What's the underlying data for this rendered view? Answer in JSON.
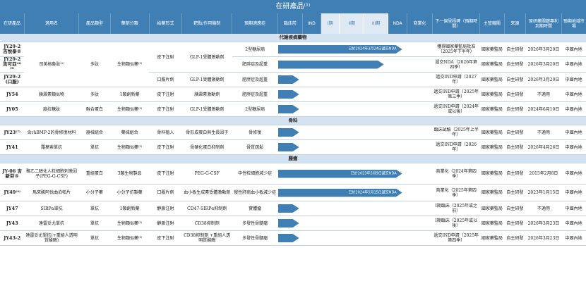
{
  "title": "在研產品⁽¹⁾",
  "headers": [
    "在研產品",
    "適用名",
    "產品類型",
    "藥劑分類",
    "給藥形式",
    "靶點/作用機制",
    "預期適應症",
    "臨床前",
    "IND",
    "I期",
    "II期",
    "III期",
    "NDA",
    "商業化",
    "下一個里程碑（預期時間）",
    "主管機關",
    "來源",
    "原研藥關鍵專利到期時間",
    "預期地域市場"
  ],
  "sections": {
    "s1": "代謝疾病藥物",
    "s2": "骨科",
    "s3": "腫瘤"
  },
  "rows": {
    "r1": {
      "code": "JY29-2 吉悅泰®",
      "name": "司美格魯肽⁽²⁾",
      "type": "多肽",
      "cls": "生物類似藥⁽³⁾",
      "form": "皮下注射",
      "target": "GLP-1受體激動劑",
      "ind": "2型糖尿病",
      "note": "已於2024年3月24日遞交NDA",
      "milestone": "獲得國家藥監局批准（2025年下半年）",
      "authority": "國家藥監局",
      "source": "自主研發",
      "patent": "2026年3月20日",
      "market": "中國內地"
    },
    "r2": {
      "code": "JY29-2 吉可亞⁽⁴⁾⁽⁵⁾",
      "ind": "肥胖症及超重",
      "milestone": "遞交NDA（2026年第四季）",
      "authority": "國家藥監局",
      "source": "自主研發",
      "patent": "2026年3月20日",
      "market": "中國內地"
    },
    "r3": {
      "code": "JY29-2 (口服)",
      "form": "口服片劑",
      "ind": "肥胖症及超重",
      "milestone": "遞交IND申請（2027年）",
      "authority": "國家藥監局",
      "source": "自主研發",
      "patent": "2026年3月20日",
      "market": "中國內地"
    },
    "r4": {
      "code": "JY54",
      "name": "胰澱素類似物",
      "type": "多肽",
      "cls": "1類創新藥",
      "form": "皮下注射",
      "target": "胰澱素激動劑",
      "ind": "肥胖症及超重",
      "milestone": "遞交IND申請（2025年第三季）",
      "authority": "國家藥監局",
      "source": "自主研發",
      "patent": "不適用",
      "market": "中國內地"
    },
    "r5": {
      "code": "JY05",
      "name": "度拉糖肽",
      "type": "融合蛋白",
      "cls": "生物類似藥⁽³⁾",
      "form": "皮下注射",
      "target": "GLP-1受體激動劑",
      "ind": "2型糖尿病",
      "milestone": "遞交IND申請（2024年或以後）",
      "authority": "國家藥監局",
      "source": "自主研發",
      "patent": "2024年6月10日",
      "market": "中國內地"
    },
    "r6": {
      "code": "JY23⁽⁷⁾",
      "name": "含rhBMP-2的骨修復材料",
      "type": "器械組合",
      "cls": "藥械組合",
      "form": "骨科植入",
      "target": "骨形成蛋白與生長因子",
      "ind": "骨修復",
      "milestone": "臨床試驗（2025年上半年）",
      "authority": "國家藥監局",
      "source": "自主研發",
      "patent": "不適用",
      "market": "中國內地"
    },
    "r7": {
      "code": "JY41",
      "name": "羅莫索單抗",
      "type": "單抗",
      "cls": "生物類似藥⁽³⁾",
      "form": "皮下注射",
      "target": "骨硬化蛋白抑制劑",
      "ind": "骨質疏鬆",
      "milestone": "遞交IND申請（2026年）",
      "authority": "國家藥監局",
      "source": "自主研發",
      "patent": "2026年4月26日",
      "market": "中國內地"
    },
    "r8": {
      "code": "JY-06 吉新芬®",
      "name": "聚乙二醇化人粒細胞刺激因子(PEG-G-CSF)",
      "type": "重組蛋白",
      "cls": "3類生物製品",
      "form": "皮下注射",
      "target": "PEG-G-CSF",
      "ind": "中性粒細胞減少症",
      "note": "已於2023年5月9日遞交NDA",
      "milestone": "商業化（2024年第四季）",
      "authority": "國家藥監局",
      "source": "自主研發",
      "patent": "2015年2月8日",
      "market": "中國內地"
    },
    "r9": {
      "code": "JY49⁽⁹⁾",
      "name": "馬來酸阿伐曲泊帕片",
      "type": "小分子藥",
      "cls": "小分子仿製藥",
      "form": "口服片劑",
      "target": "血小板生成素受體激動劑",
      "ind": "慢性肝病血小板減少症",
      "note": "已於2024年5月15日遞交NDA",
      "milestone": "商業化（2025年第四季）",
      "authority": "國家藥監局",
      "source": "自主研發",
      "patent": "2023年1月15日",
      "market": "中國內地"
    },
    "r10": {
      "code": "JY47",
      "name": "SIRPα單抗",
      "type": "單抗",
      "cls": "1類創新藥",
      "form": "靜脈注射",
      "target": "CD47-SIRPα抑制劑",
      "ind": "實體瘤",
      "milestone": "I期臨床（2025年或之前）",
      "authority": "國家藥監局",
      "source": "自主研發",
      "patent": "不適用",
      "market": "中國內地"
    },
    "r11": {
      "code": "JY43",
      "name": "達雷妥尤單抗",
      "type": "單抗",
      "cls": "生物類似藥⁽³⁾",
      "form": "靜脈注射",
      "target": "CD38抑制劑",
      "ind": "多發性骨髓瘤",
      "milestone": "I期臨床（2025年或以後）",
      "authority": "國家藥監局",
      "source": "自主研發",
      "patent": "2026年3月23日",
      "market": "中國內地"
    },
    "r12": {
      "code": "JY43-2",
      "name": "達雷妥尤單抗(+重組人透明質酸酶)",
      "type": "單抗",
      "cls": "生物類似藥⁽³⁾",
      "form": "皮下注射",
      "target": "CD38抑制劑 +重組人透明質酸酶",
      "ind": "多發性骨髓瘤",
      "milestone": "遞交IND申請（2025年第四季）",
      "authority": "國家藥監局",
      "source": "自主研發",
      "patent": "2026年3月23日",
      "market": "中國內地"
    }
  },
  "colors": {
    "accent": "#3f7fb3",
    "section": "#d3e3f1",
    "header_light": "#dfe9f3"
  },
  "bar_stage": {
    "r1": "NDA",
    "r2": "III期",
    "r3": "臨床前",
    "r4": "臨床前",
    "r5": "臨床前",
    "r6": "臨床前",
    "r7": "臨床前",
    "r8": "NDA",
    "r9": "NDA",
    "r10": "臨床前",
    "r11": "臨床前",
    "r12": "臨床前"
  }
}
